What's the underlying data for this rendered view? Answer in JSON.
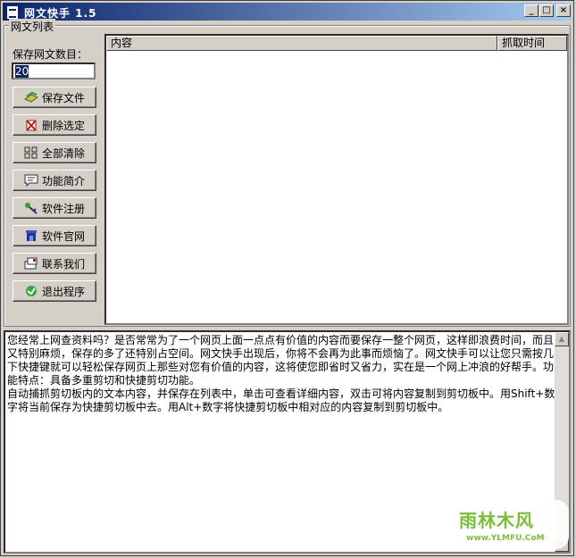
{
  "window": {
    "title": "网文快手 1.5"
  },
  "group": {
    "label": "网文列表"
  },
  "settings": {
    "count_label": "保存网文数目：",
    "count_value": "20"
  },
  "buttons": {
    "save": "保存文件",
    "delete": "删除选定",
    "clear": "全部清除",
    "intro": "功能简介",
    "register": "软件注册",
    "website": "软件官网",
    "contact": "联系我们",
    "exit": "退出程序"
  },
  "list": {
    "col_content": "内容",
    "col_time": "抓取时间"
  },
  "description": {
    "text": "您经常上网查资料吗？是否常常为了一个网页上面一点点有价值的内容而要保存一整个网页，这样即浪费时间，而且又特别麻烦，保存的多了还特别占空间。网文快手出现后，你将不会再为此事而烦恼了。网文快手可以让您只需按几下快捷键就可以轻松保存网页上那些对您有价值的内容，这将使您即省时又省力，实在是一个网上冲浪的好帮手。功能特点：具备多重剪切和快捷剪切功能。\n自动捕抓剪切板内的文本内容，并保存在列表中，单击可查看详细内容，双击可将内容复制到剪切板中。用Shift+数字将当前保存为快捷剪切板中去。用Alt+数字将快捷剪切板中相对应的内容复制到剪切板中。"
  },
  "watermark": {
    "text": "雨林木风",
    "url": "www.YLMFU.CoM"
  },
  "colors": {
    "titlebar": "#0a246a",
    "face": "#d4d0c8",
    "watermark": "#7abf3a"
  }
}
